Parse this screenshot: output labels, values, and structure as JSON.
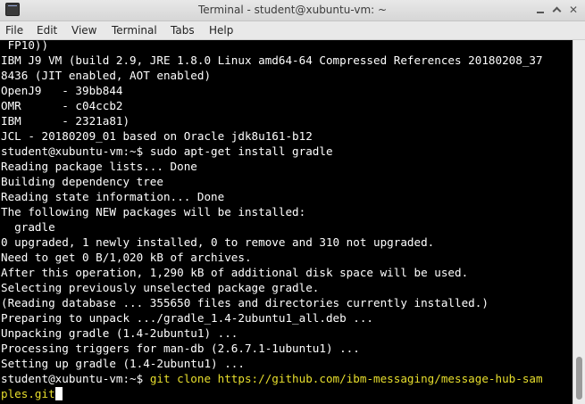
{
  "window": {
    "title": "Terminal - student@xubuntu-vm: ~"
  },
  "menubar": {
    "items": [
      {
        "label": "File"
      },
      {
        "label": "Edit"
      },
      {
        "label": "View"
      },
      {
        "label": "Terminal"
      },
      {
        "label": "Tabs"
      },
      {
        "label": "Help"
      }
    ]
  },
  "terminal": {
    "lines": [
      {
        "text": " FP10))"
      },
      {
        "text": "IBM J9 VM (build 2.9, JRE 1.8.0 Linux amd64-64 Compressed References 20180208_37"
      },
      {
        "text": "8436 (JIT enabled, AOT enabled)"
      },
      {
        "text": "OpenJ9   - 39bb844"
      },
      {
        "text": "OMR      - c04ccb2"
      },
      {
        "text": "IBM      - 2321a81)"
      },
      {
        "text": "JCL - 20180209_01 based on Oracle jdk8u161-b12"
      },
      {
        "prompt": "student@xubuntu-vm:~$ ",
        "text": "sudo apt-get install gradle"
      },
      {
        "text": "Reading package lists... Done"
      },
      {
        "text": "Building dependency tree"
      },
      {
        "text": "Reading state information... Done"
      },
      {
        "text": "The following NEW packages will be installed:"
      },
      {
        "text": "  gradle"
      },
      {
        "text": "0 upgraded, 1 newly installed, 0 to remove and 310 not upgraded."
      },
      {
        "text": "Need to get 0 B/1,020 kB of archives."
      },
      {
        "text": "After this operation, 1,290 kB of additional disk space will be used."
      },
      {
        "text": "Selecting previously unselected package gradle."
      },
      {
        "text": "(Reading database ... 355650 files and directories currently installed.)"
      },
      {
        "text": "Preparing to unpack .../gradle_1.4-2ubuntu1_all.deb ..."
      },
      {
        "text": "Unpacking gradle (1.4-2ubuntu1) ..."
      },
      {
        "text": "Processing triggers for man-db (2.6.7.1-1ubuntu1) ..."
      },
      {
        "text": "Setting up gradle (1.4-2ubuntu1) ..."
      }
    ],
    "current_prompt": "student@xubuntu-vm:~$ ",
    "current_command_line1": "git clone https://github.com/ibm-messaging/message-hub-sam",
    "current_command_line2": "ples.git"
  },
  "colors": {
    "background": "#000000",
    "text": "#ffffff",
    "typed_command": "#e8df2d"
  },
  "icons": {
    "app": "terminal-icon",
    "minimize": "minimize-icon",
    "maximize": "maximize-icon",
    "close": "close-icon"
  }
}
